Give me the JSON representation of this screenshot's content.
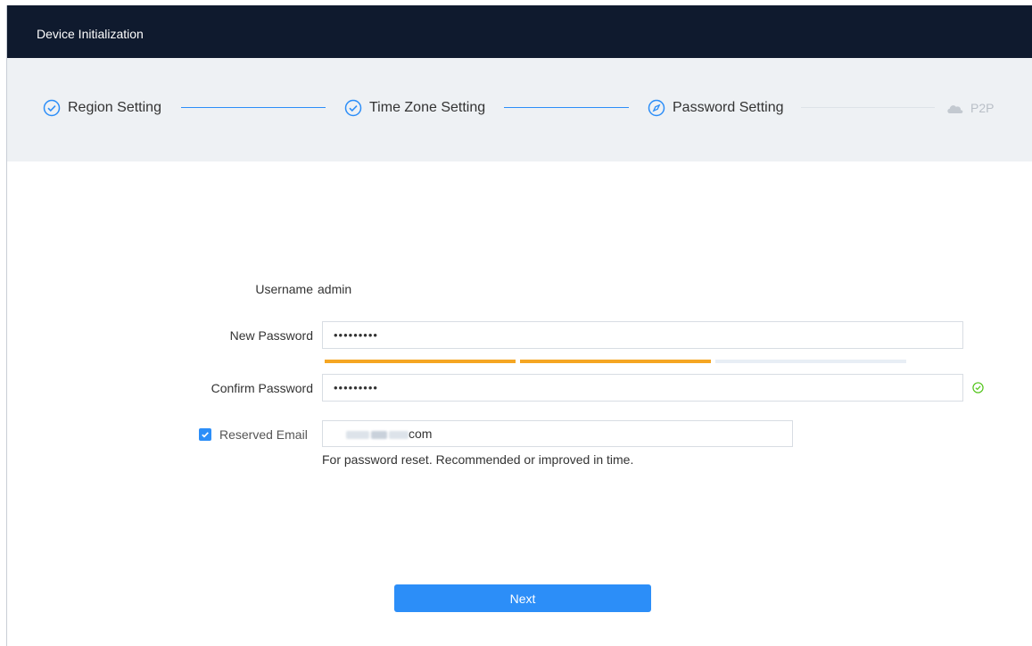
{
  "window": {
    "title": "Device Initialization"
  },
  "steps": [
    {
      "label": "Region Setting",
      "state": "done",
      "icon": "check-circle-icon"
    },
    {
      "label": "Time Zone Setting",
      "state": "done",
      "icon": "check-circle-icon"
    },
    {
      "label": "Password Setting",
      "state": "active",
      "icon": "compass-icon"
    },
    {
      "label": "P2P",
      "state": "pending",
      "icon": "cloud-icon"
    }
  ],
  "form": {
    "username_label": "Username",
    "username_value": "admin",
    "new_password_label": "New Password",
    "new_password_value": "•••••••••",
    "strength_segments_filled": 2,
    "strength_segments_total": 3,
    "confirm_password_label": "Confirm Password",
    "confirm_password_value": "•••••••••",
    "confirm_valid_icon": "check-circle-icon",
    "reserved_email_label": "Reserved Email",
    "reserved_email_checked": true,
    "reserved_email_value_visible": "com",
    "reserved_email_hint": "For password reset. Recommended or improved in time."
  },
  "buttons": {
    "next": "Next"
  },
  "colors": {
    "header_bg": "#0f1a2e",
    "steps_bg": "#eef1f4",
    "accent": "#2c8ef8",
    "strength": "#f5a623",
    "valid": "#52c41a"
  }
}
